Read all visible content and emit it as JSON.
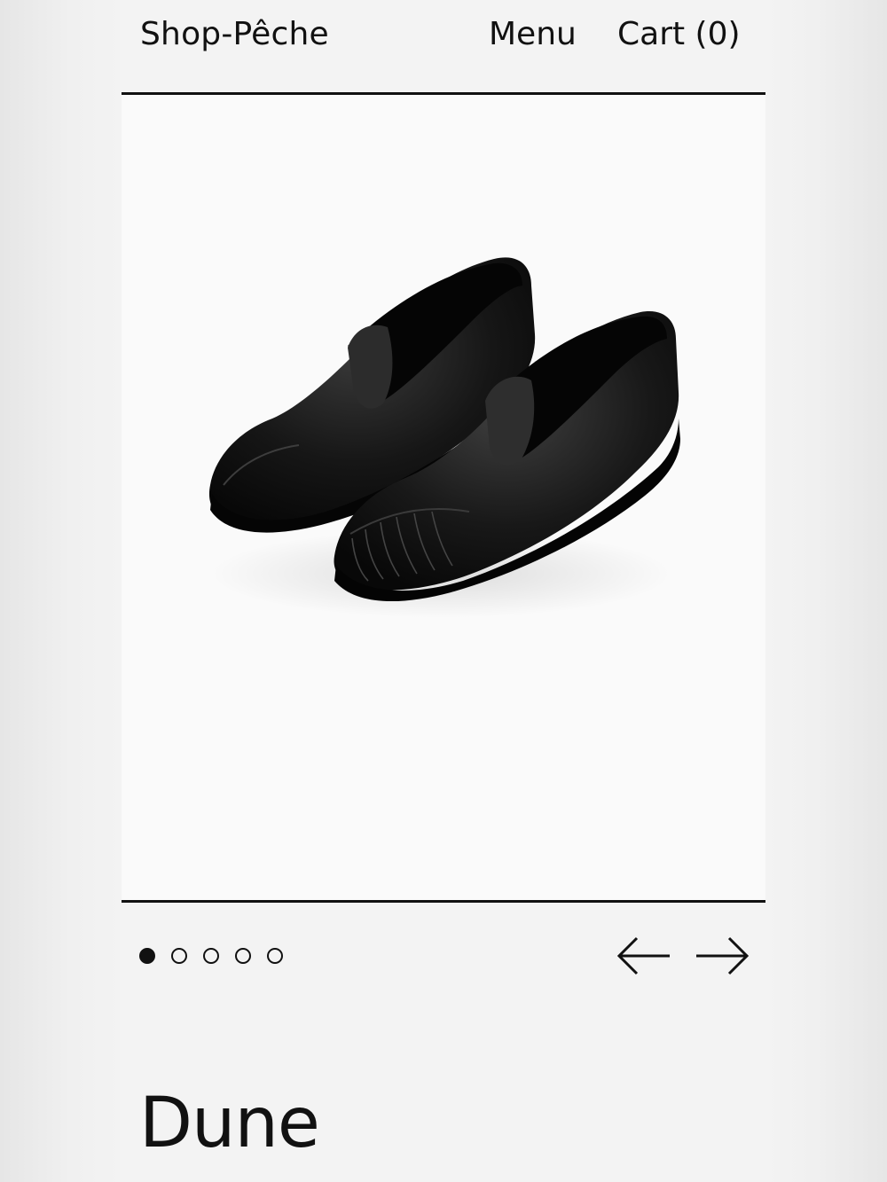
{
  "header": {
    "brand": "Shop-Pêche",
    "menu_label": "Menu",
    "cart_label": "Cart (0)"
  },
  "gallery": {
    "image_icon": "black-leather-loafers-photo",
    "slide_count": 5,
    "active_slide": 1,
    "prev_icon": "arrow-left-icon",
    "next_icon": "arrow-right-icon"
  },
  "product": {
    "name": "Dune"
  },
  "colors": {
    "text": "#111111",
    "page_bg": "#f3f3f3",
    "image_bg": "#fafafa"
  }
}
